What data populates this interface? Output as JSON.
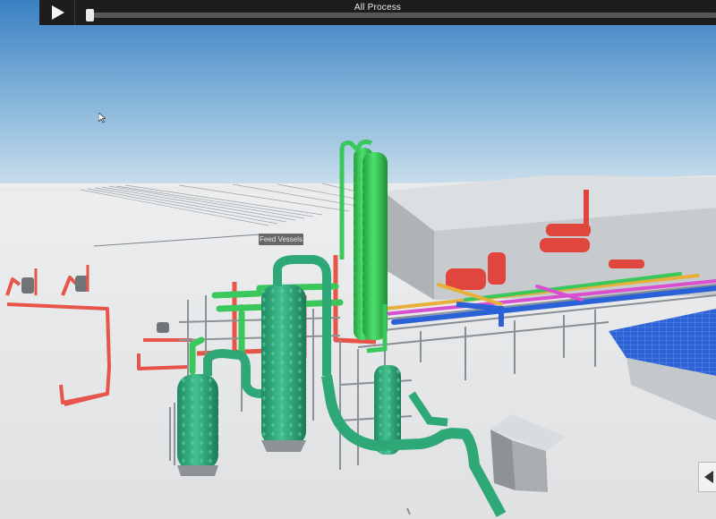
{
  "toolbar": {
    "title": "All Process",
    "play_icon": "play-icon",
    "progress": 0.0
  },
  "scene": {
    "label": "Feed Vessels"
  },
  "side_panel": {
    "icon": "chevron-left-icon"
  },
  "colors": {
    "sky_top": "#3f85c4",
    "sky_bottom": "#c9dce9",
    "ground": "#e6e7e9",
    "hall": "#bfc3c6",
    "teal_vessel": "#2fa878",
    "green_column": "#3ac75c",
    "red_pipe": "#e94b42",
    "blue_pipe": "#2a61d6",
    "yellow_pipe": "#e8b03a",
    "magenta_pipe": "#d94fd1",
    "steel": "#8d9296"
  }
}
